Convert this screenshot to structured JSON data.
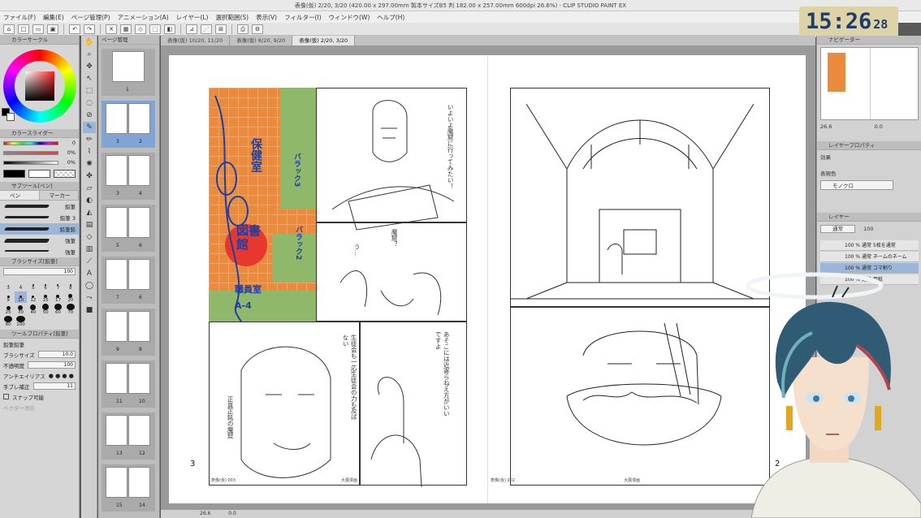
{
  "window": {
    "title": "表像(仮) 2/20, 3/20 (420.00 x 297.00mm 製本サイズB5 判 182.00 x 257.00mm 600dpi 26.6%) - CLIP STUDIO PAINT EX"
  },
  "menu": [
    "ファイル(F)",
    "編集(E)",
    "ページ管理(P)",
    "アニメーション(A)",
    "レイヤー(L)",
    "選択範囲(S)",
    "表示(V)",
    "フィルター(I)",
    "ウィンドウ(W)",
    "ヘルプ(H)"
  ],
  "clock": {
    "time": "15:26",
    "seconds": "28"
  },
  "panels": {
    "color_circle": "カラーサークル",
    "color_slider": "カラースライダー",
    "sub_tool": "サブツール[ペン]",
    "brush_size": "ブラシサイズ[鉛筆]",
    "tool_property": "ツールプロパティ[鉛筆]",
    "page_manager": "ページ管理",
    "navigator": "ナビゲーター",
    "layer_property": "レイヤープロパティ",
    "layer": "レイヤー"
  },
  "color_sliders": [
    {
      "value": "0"
    },
    {
      "value": "0%"
    },
    {
      "value": "0%"
    }
  ],
  "brush_tabs": [
    "ペン",
    "マーカー"
  ],
  "brushes": [
    {
      "name": "鉛筆"
    },
    {
      "name": "鉛筆 3"
    },
    {
      "name": "鉛筆鉛"
    },
    {
      "name": "強筆"
    },
    {
      "name": "強筆"
    }
  ],
  "brush_size_value": "100",
  "brush_sizes": [
    "3",
    "4",
    "5",
    "6",
    "7",
    "8",
    "9",
    "10",
    "12",
    "15",
    "17",
    "20",
    "25",
    "30",
    "40",
    "50",
    "60",
    "70",
    "80",
    "100"
  ],
  "tool_props": {
    "name": "鉛筆鉛筆",
    "brush_size_label": "ブラシサイズ",
    "brush_size": "10.0",
    "opacity_label": "不透明度",
    "opacity": "100",
    "anti_alias_label": "アンチエイリアス",
    "stabilization_label": "手ブレ補正",
    "stabilization": "11",
    "snap_label": "スナップ可能",
    "vector_erase_label": "ベクター消去"
  },
  "doc_tabs": [
    {
      "label": "表像(仮) 10/20, 11/20"
    },
    {
      "label": "表像(仮) 8/20, 9/20"
    },
    {
      "label": "表像(仮) 2/20, 3/20"
    }
  ],
  "pages": [
    {
      "left": "",
      "right": "1"
    },
    {
      "left": "3",
      "right": "2"
    },
    {
      "left": "3",
      "right": "4"
    },
    {
      "left": "5",
      "right": "6"
    },
    {
      "left": "7",
      "right": "6"
    },
    {
      "left": "9",
      "right": "8"
    },
    {
      "left": "11",
      "right": "10"
    },
    {
      "left": "13",
      "right": "12"
    },
    {
      "left": "15",
      "right": "14"
    }
  ],
  "canvas": {
    "page_left_number": "3",
    "page_right_number": "2",
    "map_labels": {
      "room1": "保健室",
      "library": "図書館",
      "room2": "職員室",
      "code": "A-4",
      "road1": "バラック3",
      "road2": "バラック2"
    },
    "dialogue": {
      "d1": "いよいよ魔窟に行ってみたい！",
      "d2": "魔窟？",
      "d3": "う…",
      "d4": "あそこには近寄らねえ方がいいですよ",
      "d5": "生徒会も一応生徒会の力も及ばない",
      "d6": "正真正銘の魔窟"
    },
    "footer_left": "表像(仮) 003",
    "footer_center_left": "大展漫画",
    "footer_right": "表像(仮) 002",
    "footer_center_right": "大展漫画"
  },
  "status": {
    "zoom": "26.6",
    "angle": "0.0"
  },
  "right_panel": {
    "zoom": "26.6",
    "angle": "0.0",
    "effect_label": "効果",
    "expression_label": "表現色",
    "expression_value": "モノクロ",
    "blend_mode": "通常",
    "opacity": "100"
  },
  "layers": [
    {
      "name": "100 % 通常 5枚を通常"
    },
    {
      "name": "100 % 通常 ネームのネーム"
    },
    {
      "name": "100 % 通常 コマ割り"
    },
    {
      "name": "100 % 通常 用紙"
    }
  ],
  "colors": {
    "accent": "#9bb6d6",
    "map_orange": "#e98a3d",
    "map_red": "#e8372c",
    "map_blue": "#1e3fa5",
    "clock_bg": "#ddd3a6",
    "clock_fg": "#1f3d6b"
  }
}
